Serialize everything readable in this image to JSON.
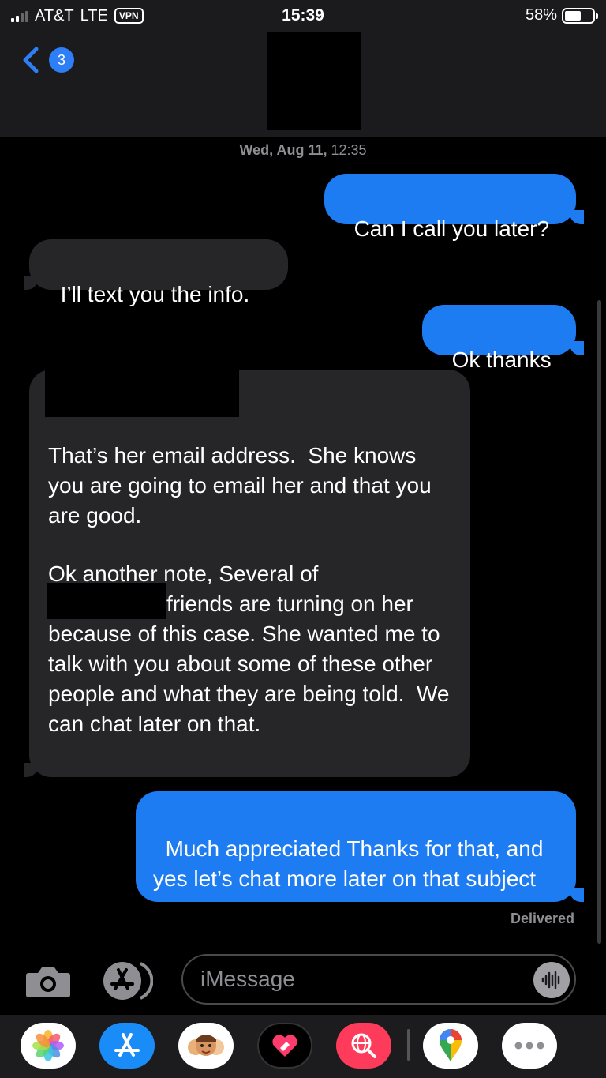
{
  "status_bar": {
    "carrier": "AT&T",
    "network": "LTE",
    "vpn": "VPN",
    "time": "15:39",
    "battery": "58%",
    "battery_level": 0.58
  },
  "header": {
    "back_badge_count": "3"
  },
  "conversation": {
    "timestamp_day": "Wed, Aug 11,",
    "timestamp_time": "12:35",
    "messages": [
      {
        "direction": "sent",
        "text": "Can I call you later?"
      },
      {
        "direction": "received",
        "text": "I’ll text you the info."
      },
      {
        "direction": "sent",
        "text": "Ok thanks"
      },
      {
        "direction": "received",
        "text": "That’s her email address.  She knows you are going to email her and that you are good."
      },
      {
        "direction": "received",
        "text_parts": [
          "Ok another note, Several of",
          "friends are turning on her because of this case. She wanted me to talk with you about some of these other people and what they are being told.  We can chat later on that."
        ]
      },
      {
        "direction": "sent",
        "text": "Much appreciated Thanks for that, and yes let’s chat more later on that subject"
      }
    ],
    "delivery_status": "Delivered"
  },
  "input_bar": {
    "placeholder": "iMessage"
  },
  "app_drawer": {
    "apps": [
      "photos-icon",
      "app-store-icon",
      "memoji-icon",
      "digital-touch-icon",
      "web-images-icon",
      "google-maps-icon",
      "more-icon"
    ]
  },
  "colors": {
    "sent_bubble": "#1d7cf2",
    "received_bubble": "#262628",
    "accent": "#2d7ef7"
  }
}
